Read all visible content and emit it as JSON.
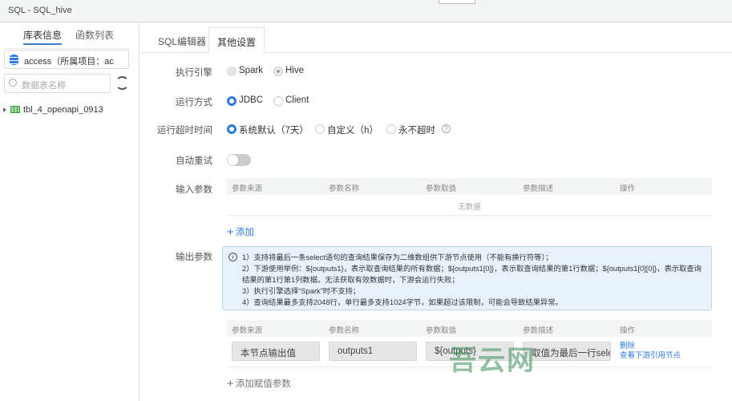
{
  "window": {
    "title": "SQL - SQL_hive"
  },
  "sidebar": {
    "tabs": [
      {
        "label": "库表信息",
        "active": true
      },
      {
        "label": "函数列表",
        "active": false
      }
    ],
    "database_select": "access（所属项目：ac",
    "search_placeholder": "数据表名称",
    "tree": [
      {
        "label": "tbl_4_openapi_0913"
      }
    ]
  },
  "main": {
    "tabs": [
      {
        "label": "SQL编辑器",
        "active": false
      },
      {
        "label": "其他设置",
        "active": true
      }
    ],
    "engine": {
      "label": "执行引擎",
      "options": [
        "Spark",
        "Hive"
      ],
      "selected": "Hive"
    },
    "run_mode": {
      "label": "运行方式",
      "options": [
        "JDBC",
        "Client"
      ],
      "selected": "JDBC"
    },
    "timeout": {
      "label": "运行超时时间",
      "options": [
        "系统默认（7天）",
        "自定义（h）",
        "永不超时"
      ],
      "selected": "系统默认（7天）",
      "help": "?"
    },
    "retry": {
      "label": "自动重试",
      "on": false
    },
    "input_params": {
      "label": "输入参数",
      "columns": [
        "参数来源",
        "参数名称",
        "参数取值",
        "参数描述",
        "操作"
      ],
      "empty": "无数据",
      "add": "添加"
    },
    "output_params": {
      "label": "输出参数",
      "info": [
        "1）支持将最后一条select语句的查询结果保存为二维数组供下游节点使用（不能有换行符等）；",
        "2）下游使用举例：${outputs1}，表示取查询结果的所有数据；${outputs1[0]}，表示取查询结果的第1行数据；${outputs1[0][0]}，表示取查询结果的第1行第1列数据。无法获取有效数据时，下游会运行失败；",
        "3）执行引擎选择“Spark”时不支持；",
        "4）查询结果最多支持2048行，单行最多支持1024字节，如果超过该限制，可能会导致结果异常。"
      ],
      "columns": [
        "参数来源",
        "参数名称",
        "参数取值",
        "参数描述",
        "操作"
      ],
      "rows": [
        {
          "source": "本节点输出值",
          "name": "outputs1",
          "value": "${outputs}",
          "desc": "取值为最后一行sele",
          "delete": "删除",
          "view": "查看下游引用节点"
        }
      ],
      "add": "添加赋值参数"
    },
    "watermark": "吾云网"
  },
  "colors": {
    "accent": "#2e7be0",
    "info_bg": "#e9f2fb"
  }
}
